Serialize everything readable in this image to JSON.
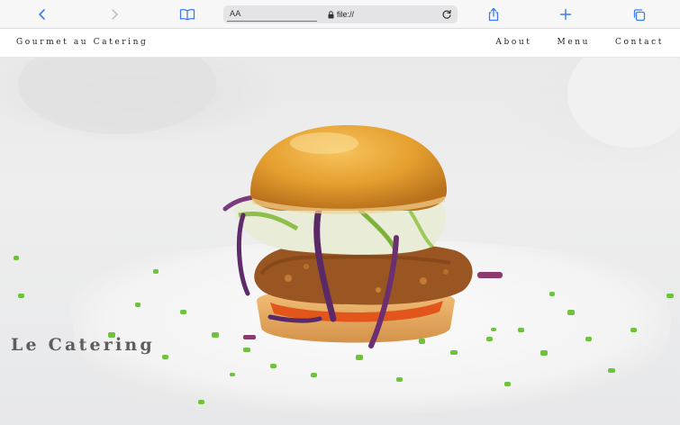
{
  "browser": {
    "address_prefix": "AA",
    "url": "file://",
    "icons": {
      "back": "chevron-left-icon",
      "forward": "chevron-right-icon",
      "bookmarks": "book-icon",
      "lock": "lock-icon",
      "reload": "reload-icon",
      "share": "share-icon",
      "new_tab": "plus-icon",
      "tabs": "tabs-icon"
    },
    "accent_color": "#3b7cf4"
  },
  "site": {
    "brand": "Gourmet au Catering",
    "nav": [
      {
        "label": "About"
      },
      {
        "label": "Menu"
      },
      {
        "label": "Contact"
      }
    ]
  },
  "hero": {
    "title": "Le Catering",
    "image": "burger-photo"
  }
}
